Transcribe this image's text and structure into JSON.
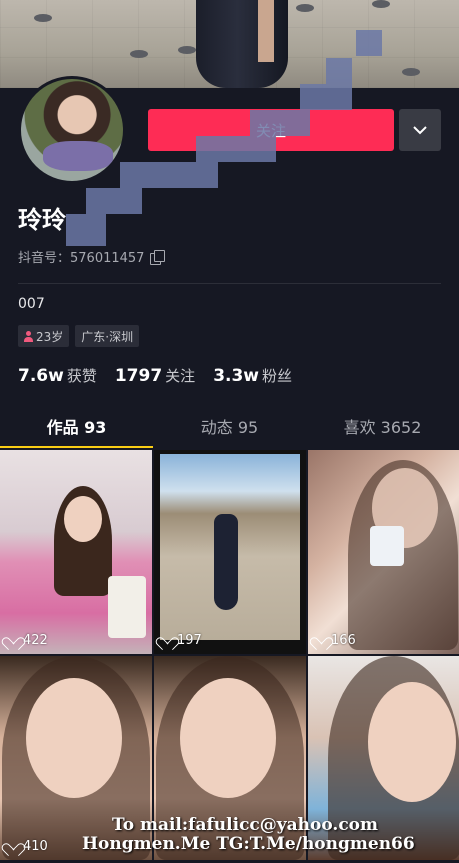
{
  "profile": {
    "follow_label": "关注",
    "name": "玲玲",
    "douyin_id": "抖音号：576011457",
    "bio": "007",
    "tags": [
      {
        "label": "23岁",
        "icon": "person-icon"
      },
      {
        "label": "广东·深圳"
      }
    ],
    "stats": [
      {
        "value": "7.6w",
        "label": "获赞"
      },
      {
        "value": "1797",
        "label": "关注"
      },
      {
        "value": "3.3w",
        "label": "粉丝"
      }
    ]
  },
  "tabs": [
    {
      "label": "作品 93",
      "active": true
    },
    {
      "label": "动态 95",
      "active": false
    },
    {
      "label": "喜欢 3652",
      "active": false
    }
  ],
  "videos": [
    {
      "likes": "422"
    },
    {
      "likes": "197"
    },
    {
      "likes": "166"
    },
    {
      "likes": "410"
    },
    {
      "likes": ""
    },
    {
      "likes": ""
    }
  ],
  "watermark": {
    "line1": "To mail:fafulicc@yahoo.com",
    "line2": "Hongmen.Me TG:T.Me/hongmen66"
  },
  "colors": {
    "background": "#161823",
    "follow": "#fe2c55",
    "tab_indicator": "#face15"
  }
}
